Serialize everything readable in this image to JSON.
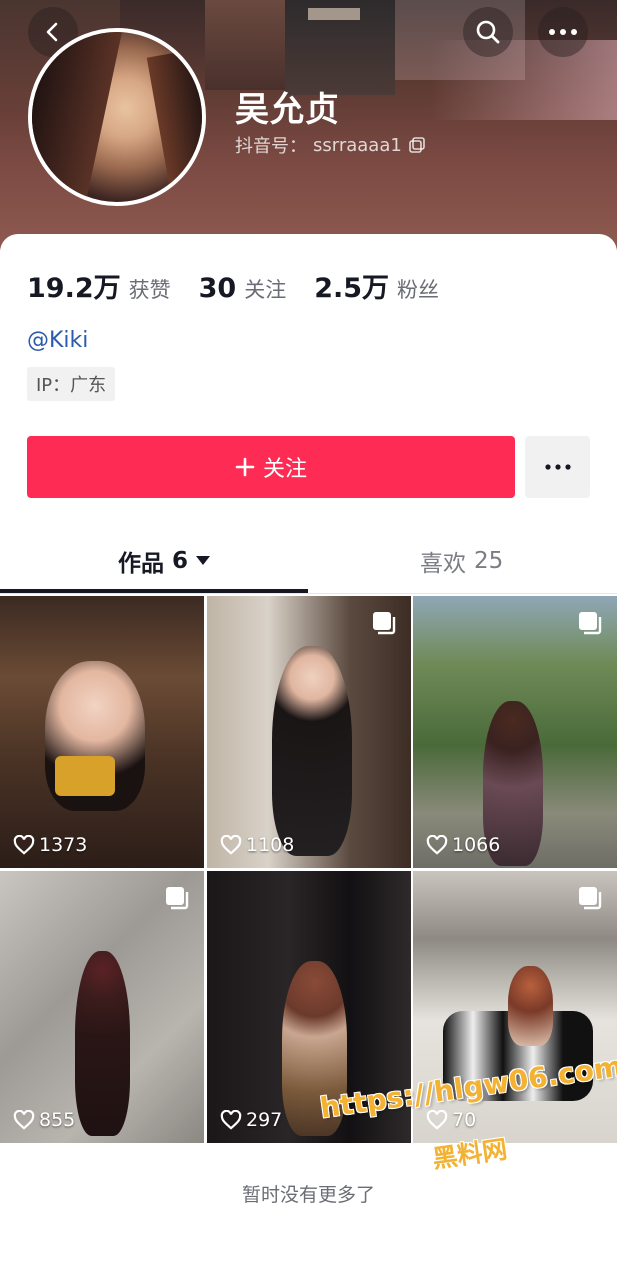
{
  "profile": {
    "name": "吴允贞",
    "douyin_id_label": "抖音号：",
    "douyin_id": "ssrraaaa1",
    "handle": "@Kiki",
    "ip": "IP：广东"
  },
  "stats": [
    {
      "num": "19.2万",
      "label": "获赞"
    },
    {
      "num": "30",
      "label": "关注"
    },
    {
      "num": "2.5万",
      "label": "粉丝"
    }
  ],
  "actions": {
    "follow_label": "关注"
  },
  "tabs": {
    "works_label": "作品",
    "works_count": "6",
    "likes_label": "喜欢",
    "likes_count": "25"
  },
  "videos": [
    {
      "likes": "1373",
      "multi": false
    },
    {
      "likes": "1108",
      "multi": true
    },
    {
      "likes": "1066",
      "multi": true
    },
    {
      "likes": "855",
      "multi": true
    },
    {
      "likes": "297",
      "multi": false
    },
    {
      "likes": "70",
      "multi": true
    }
  ],
  "footer": {
    "no_more": "暂时没有更多了"
  },
  "watermark": {
    "url": "https://hlgw06.com",
    "sub": "黑料网"
  },
  "colors": {
    "accent": "#fe2c55",
    "link": "#2c5bab",
    "watermark": "#f3b232"
  },
  "icons": [
    "back-icon",
    "search-icon",
    "more-icon",
    "copy-icon",
    "plus-icon",
    "triangle-down-icon",
    "heart-icon",
    "multi-image-icon"
  ]
}
